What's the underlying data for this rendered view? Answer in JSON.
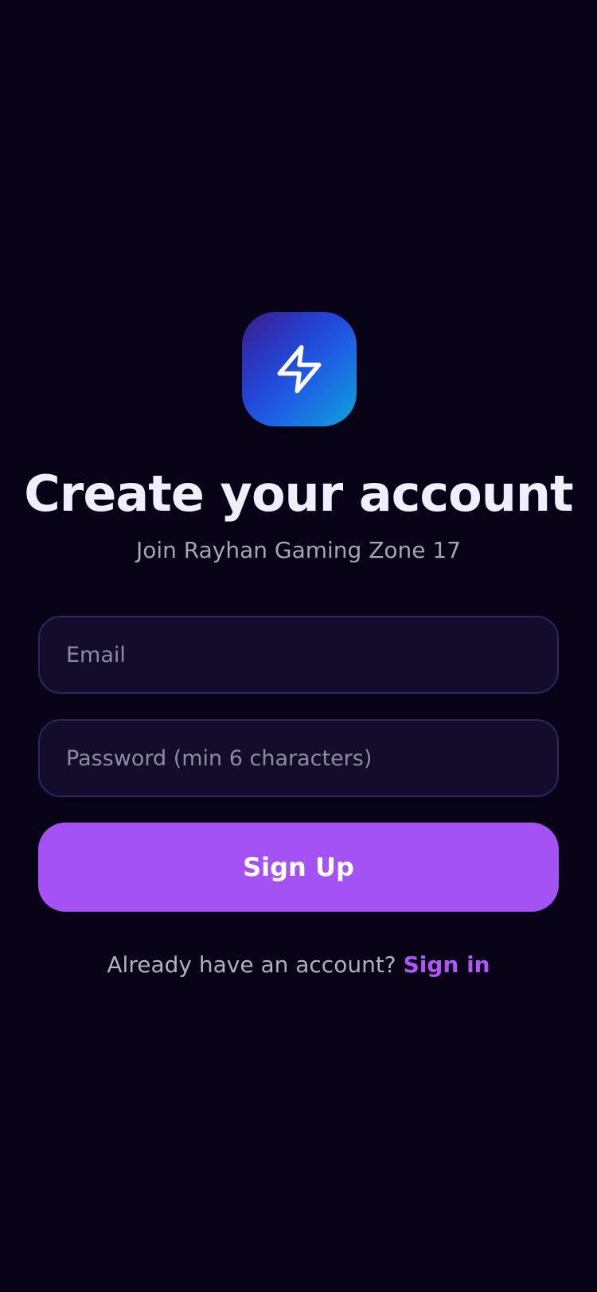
{
  "app": {
    "logo_icon": "lightning-bolt-icon",
    "accent_color": "#a552f4",
    "background_color": "#070216"
  },
  "signup": {
    "title": "Create your account",
    "subtitle": "Join Rayhan Gaming Zone 17",
    "email": {
      "value": "",
      "placeholder": "Email"
    },
    "password": {
      "value": "",
      "placeholder": "Password (min 6 characters)"
    },
    "submit_label": "Sign Up",
    "footer_text": "Already have an account?",
    "signin_label": "Sign in"
  }
}
